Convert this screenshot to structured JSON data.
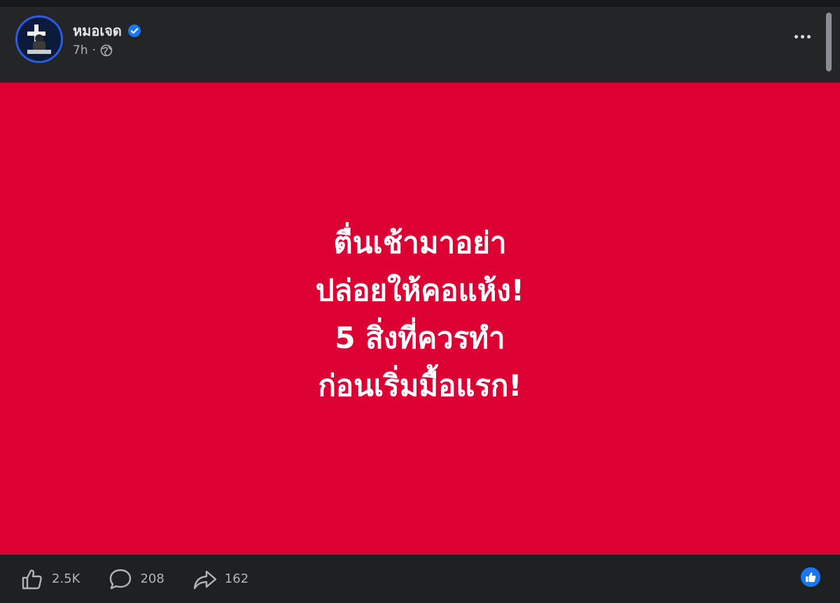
{
  "post": {
    "author": "หมอเจด",
    "time": "7h",
    "separator": "·",
    "image_text": [
      "ตื่นเช้ามาอย่า",
      "ปล่อยให้คอแห้ง!",
      "5 สิ่งที่ควรทำ",
      "ก่อนเริ่มมื้อแรก!"
    ]
  },
  "actions": {
    "likes": "2.5K",
    "comments": "208",
    "shares": "162"
  },
  "colors": {
    "media_background": "#dc0033",
    "accent": "#1877f2"
  },
  "icons": [
    "verified-badge-icon",
    "globe-icon",
    "more-options-icon",
    "like-icon",
    "comment-icon",
    "share-icon",
    "like-reaction-icon"
  ]
}
